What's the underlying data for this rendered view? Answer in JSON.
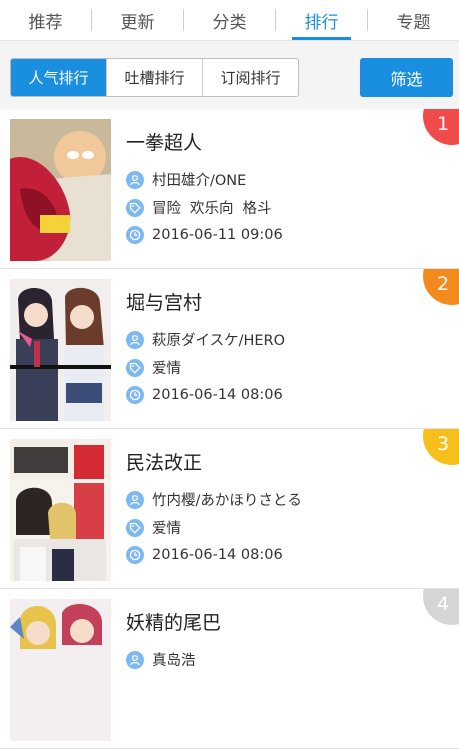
{
  "topnav": {
    "tabs": [
      {
        "label": "推荐",
        "active": false
      },
      {
        "label": "更新",
        "active": false
      },
      {
        "label": "分类",
        "active": false
      },
      {
        "label": "排行",
        "active": true
      },
      {
        "label": "专题",
        "active": false
      }
    ]
  },
  "subbar": {
    "segments": [
      {
        "label": "人气排行",
        "active": true
      },
      {
        "label": "吐槽排行",
        "active": false
      },
      {
        "label": "订阅排行",
        "active": false
      }
    ],
    "filter_label": "筛选"
  },
  "colors": {
    "accent": "#1a8fe0",
    "icon_circle": "#7db8ee",
    "rank_1": "#ef4b4b",
    "rank_2": "#f38a1d",
    "rank_3": "#f7bf1c",
    "rank_4": "#d5d5d5"
  },
  "list": [
    {
      "rank": "1",
      "title": "一拳超人",
      "author": "村田雄介/ONE",
      "tags": [
        "冒险",
        "欢乐向",
        "格斗"
      ],
      "date": "2016-06-11 09:06"
    },
    {
      "rank": "2",
      "title": "堀与宫村",
      "author": "萩原ダイスケ/HERO",
      "tags": [
        "爱情"
      ],
      "date": "2016-06-14 08:06"
    },
    {
      "rank": "3",
      "title": "民法改正",
      "author": "竹内樱/あかほりさとる",
      "tags": [
        "爱情"
      ],
      "date": "2016-06-14 08:06"
    },
    {
      "rank": "4",
      "title": "妖精的尾巴",
      "author": "真岛浩",
      "tags": [],
      "date": ""
    }
  ],
  "icons": {
    "author": "user-icon",
    "tags": "tag-icon",
    "date": "clock-icon"
  }
}
